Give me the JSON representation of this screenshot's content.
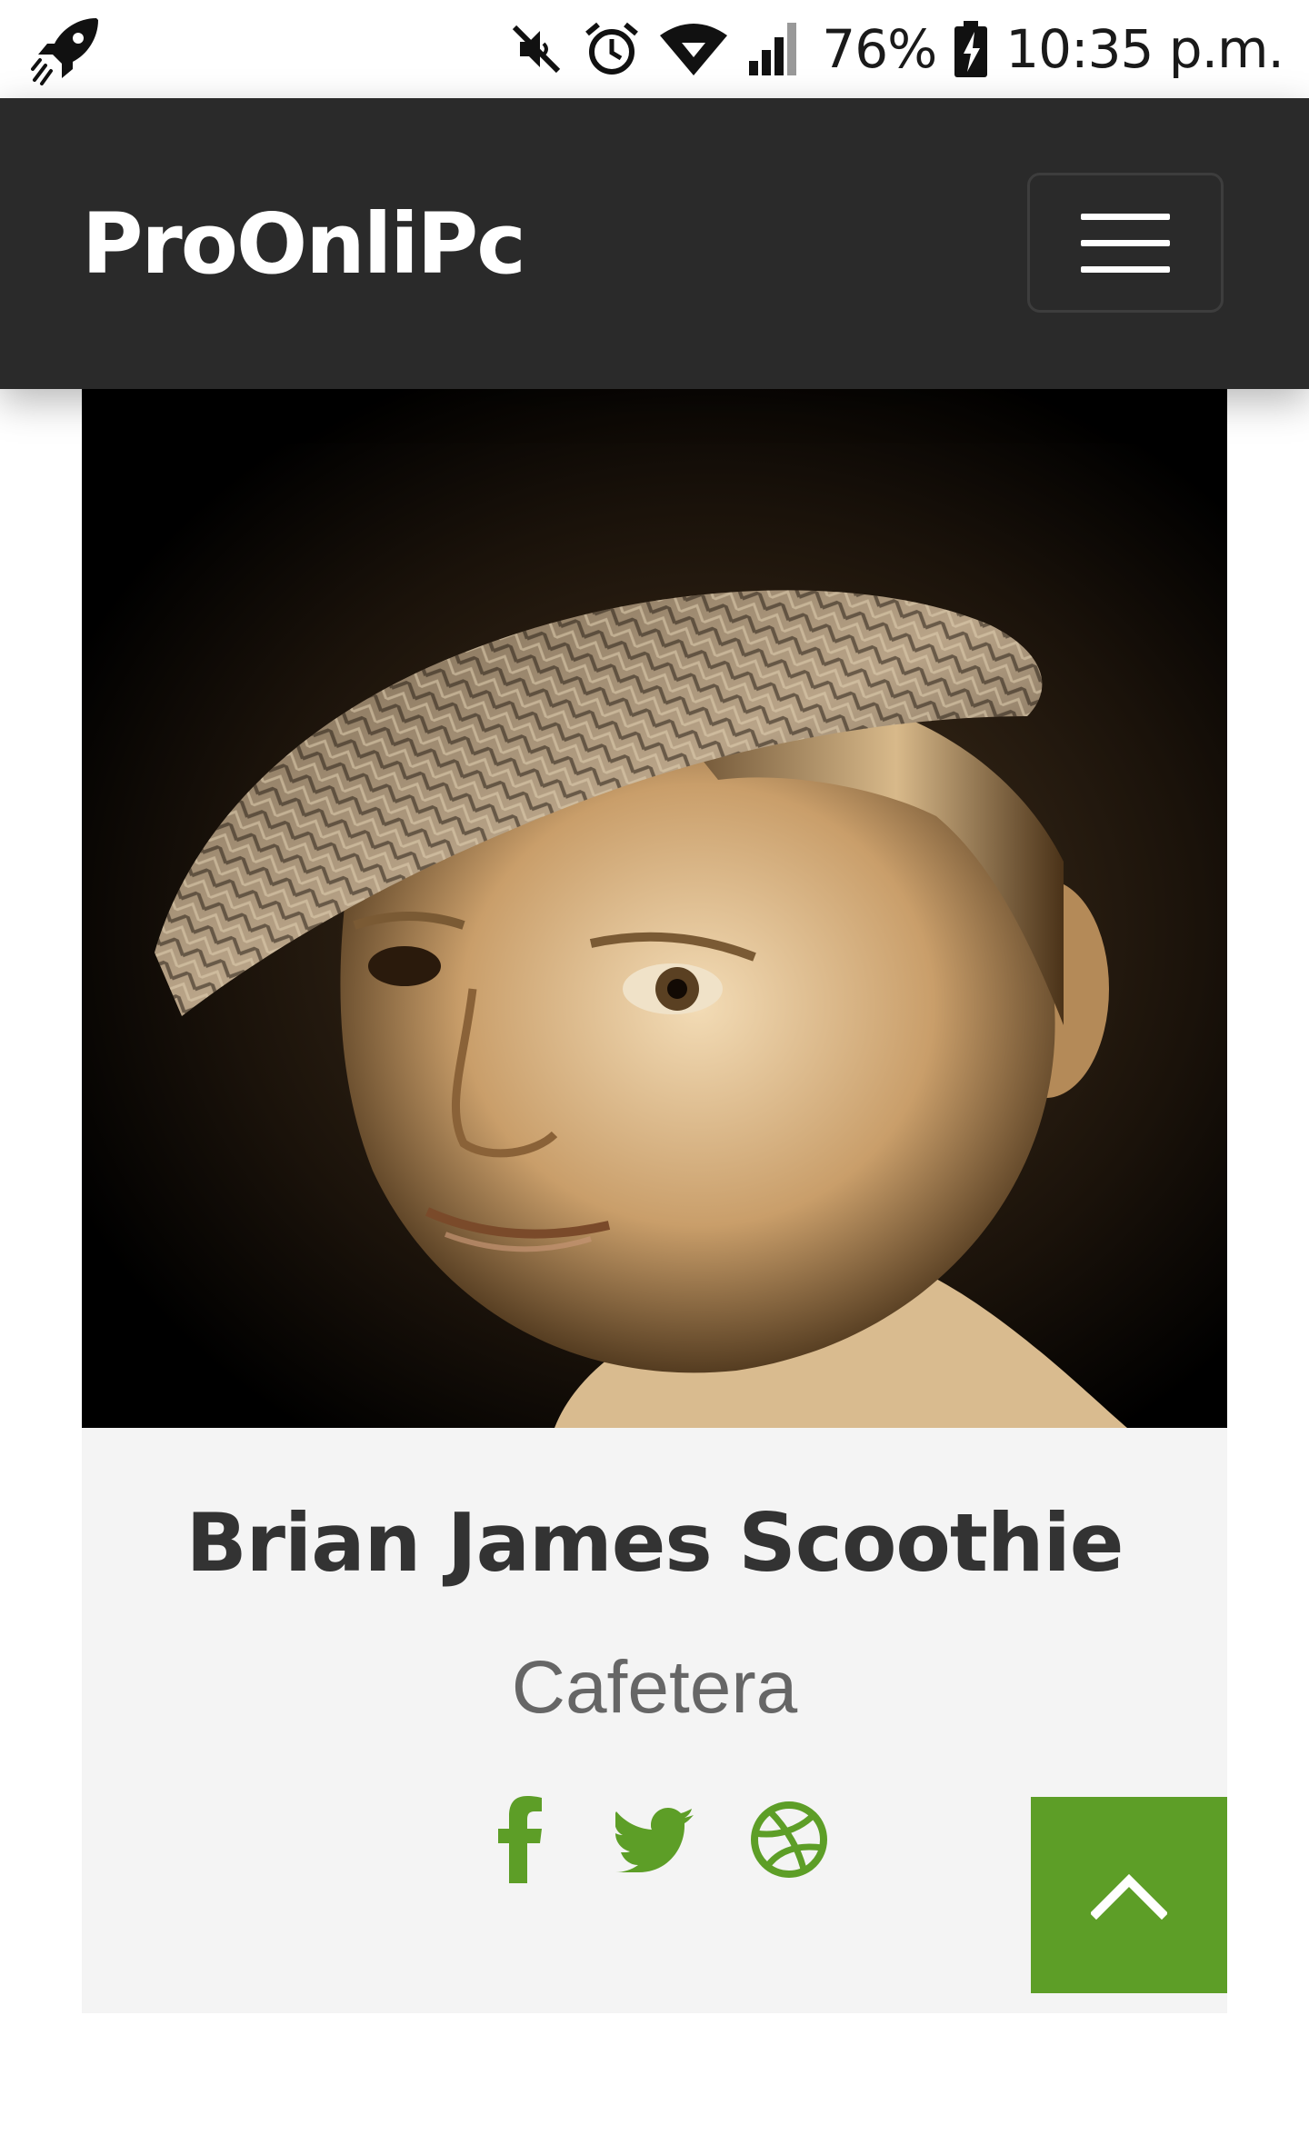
{
  "status_bar": {
    "app_icon": "rocket-icon",
    "battery_percent": "76%",
    "time": "10:35 p.m.",
    "icons": [
      "mute-icon",
      "alarm-icon",
      "wifi-icon",
      "signal-icon",
      "battery-charging-icon"
    ]
  },
  "navbar": {
    "brand": "ProOnliPc",
    "menu_icon": "hamburger-menu-icon",
    "background": "#2a2a2a"
  },
  "profile": {
    "name": "Brian James Scoothie",
    "role": "Cafetera",
    "photo_alt": "portrait-photo",
    "social_links": [
      "facebook-icon",
      "twitter-icon",
      "dribbble-icon"
    ],
    "accent_color": "#5d9e27"
  },
  "scroll_top": {
    "icon": "chevron-up-icon"
  }
}
